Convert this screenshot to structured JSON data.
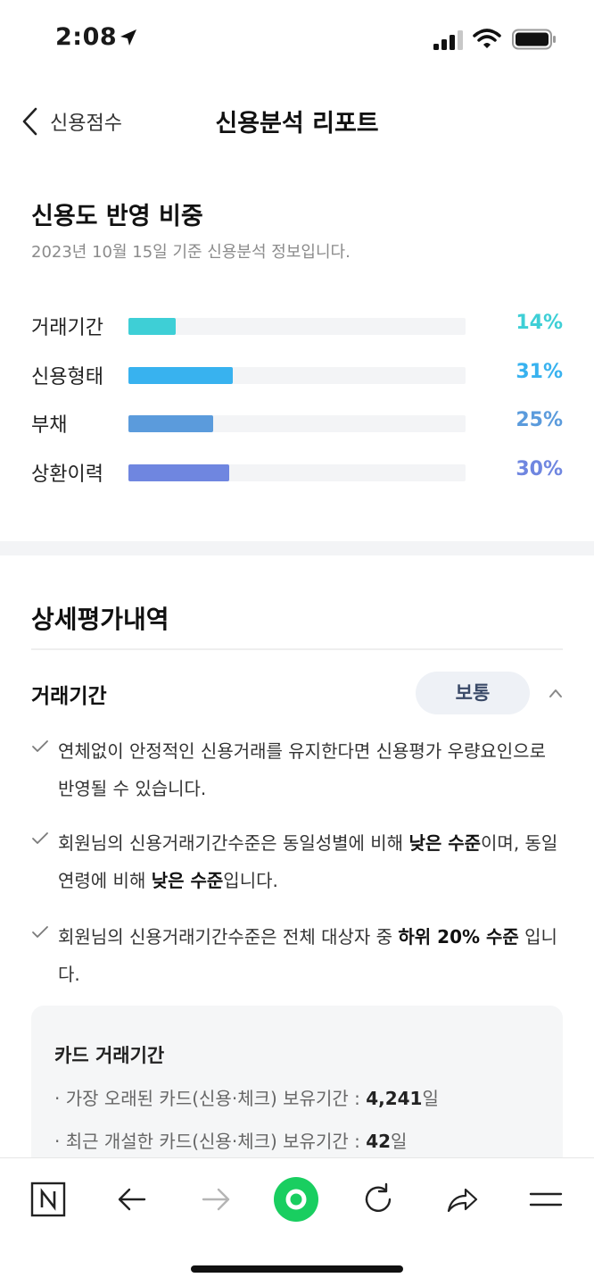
{
  "status_bar": {
    "time": "2:08"
  },
  "nav": {
    "back_label": "신용점수",
    "title": "신용분석 리포트"
  },
  "weights": {
    "title": "신용도 반영 비중",
    "subtitle": "2023년 10월 15일 기준 신용분석 정보입니다.",
    "items": [
      {
        "label": "거래기간",
        "value": 14,
        "display": "14%",
        "color": "#3ecfd6"
      },
      {
        "label": "신용형태",
        "value": 31,
        "display": "31%",
        "color": "#38b2ef"
      },
      {
        "label": "부채",
        "value": 25,
        "display": "25%",
        "color": "#5b9bdc"
      },
      {
        "label": "상환이력",
        "value": 30,
        "display": "30%",
        "color": "#6f86e0"
      }
    ]
  },
  "detail": {
    "title": "상세평가내역",
    "item_title": "거래기간",
    "badge": "보통",
    "notes": [
      {
        "pre": "연체없이 안정적인 신용거래를 유지한다면 신용평가 우량요인으로 반영될 수 있습니다.",
        "b1": "",
        "mid": "",
        "b2": "",
        "post": ""
      },
      {
        "pre": "회원님의 신용거래기간수준은 동일성별에 비해 ",
        "b1": "낮은 수준",
        "mid": "이며, 동일연령에 비해 ",
        "b2": "낮은 수준",
        "post": "입니다."
      },
      {
        "pre": "회원님의 신용거래기간수준은 전체 대상자 중 ",
        "b1": "하위 20% 수준",
        "mid": " 입니다.",
        "b2": "",
        "post": ""
      }
    ],
    "card": {
      "title": "카드 거래기간",
      "lines": [
        {
          "text": "· 가장 오래된 카드(신용·체크) 보유기간 : ",
          "value": "4,241",
          "unit": "일"
        },
        {
          "text": "· 최근 개설한 카드(신용·체크) 보유기간 : ",
          "value": "42",
          "unit": "일"
        }
      ]
    }
  },
  "toolbar": {
    "icons": [
      "naver-n-icon",
      "back-arrow-icon",
      "forward-arrow-icon",
      "home-circle-icon",
      "reload-icon",
      "share-icon",
      "menu-icon"
    ],
    "accent": "#19ce60"
  }
}
